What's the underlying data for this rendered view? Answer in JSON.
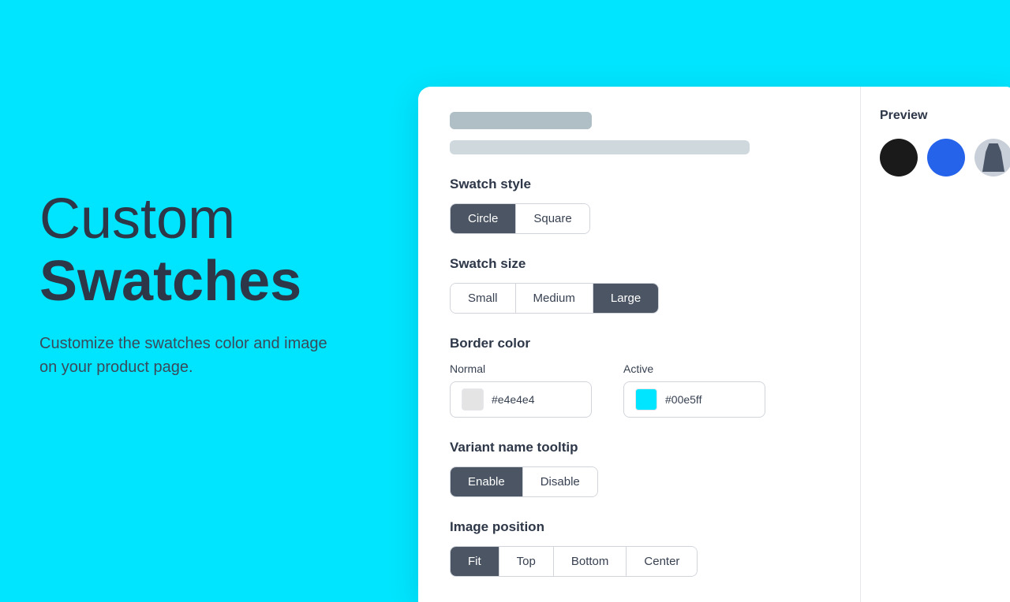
{
  "left": {
    "title_light": "Custom",
    "title_bold": "Swatches",
    "description": "Customize the swatches color and image on your product page."
  },
  "card": {
    "skeleton": {
      "bar1_label": "",
      "bar2_label": ""
    },
    "swatch_style": {
      "label": "Swatch style",
      "options": [
        "Circle",
        "Square"
      ],
      "active": "Circle"
    },
    "swatch_size": {
      "label": "Swatch size",
      "options": [
        "Small",
        "Medium",
        "Large"
      ],
      "active": "Large"
    },
    "border_color": {
      "label": "Border color",
      "normal": {
        "label": "Normal",
        "color": "#e4e4e4",
        "value": "#e4e4e4"
      },
      "active": {
        "label": "Active",
        "color": "#00e5ff",
        "value": "#00e5ff"
      }
    },
    "variant_tooltip": {
      "label": "Variant name tooltip",
      "options": [
        "Enable",
        "Disable"
      ],
      "active": "Enable"
    },
    "image_position": {
      "label": "Image position",
      "options": [
        "Fit",
        "Top",
        "Bottom",
        "Center"
      ],
      "active": "Fit"
    }
  },
  "preview": {
    "title": "Preview",
    "swatches": [
      {
        "color": "black",
        "label": "Black"
      },
      {
        "color": "blue",
        "label": "Blue"
      },
      {
        "color": "image",
        "label": "Image"
      }
    ]
  }
}
